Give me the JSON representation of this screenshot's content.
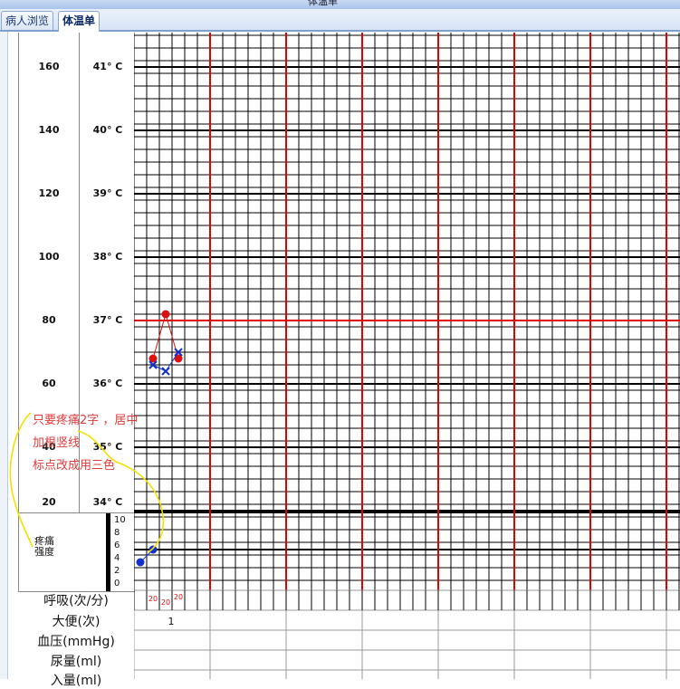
{
  "window": {
    "title": "体温单"
  },
  "tabs": [
    {
      "label": "病人浏览",
      "active": false
    },
    {
      "label": "体温单",
      "active": true
    }
  ],
  "pulse_scale": [
    "160",
    "140",
    "120",
    "100",
    "80",
    "60",
    "40",
    "20"
  ],
  "temp_scale": [
    "41° C",
    "40° C",
    "39° C",
    "38° C",
    "37° C",
    "36° C",
    "35° C",
    "34° C"
  ],
  "pain": {
    "label_line1": "疼痛",
    "label_line2": "强度",
    "scale": [
      "10",
      "8",
      "6",
      "4",
      "2",
      "0"
    ]
  },
  "rows": {
    "respiration": "呼吸(次/分)",
    "stool": "大便(次)",
    "blood_pressure": "血压(mmHg)",
    "urine": "尿量(ml)",
    "intake": "入量(ml)"
  },
  "values": {
    "respiration": [
      "20",
      "20",
      "20"
    ],
    "stool": "1"
  },
  "annotations": {
    "line1": "只要疼痛2字 ，居中",
    "line2": "加根竖线",
    "line3": "标点改成用三色"
  },
  "chart_data": {
    "type": "scatter",
    "temperature_red": [
      {
        "slot": 1,
        "temp": 36.4
      },
      {
        "slot": 2,
        "temp": 37.1
      },
      {
        "slot": 3,
        "temp": 36.4
      }
    ],
    "temperature_blue_x": [
      {
        "slot": 1,
        "temp": 36.3
      },
      {
        "slot": 2,
        "temp": 36.2
      },
      {
        "slot": 3,
        "temp": 36.5
      }
    ],
    "pain_points": [
      {
        "slot": 0,
        "pain": 3
      },
      {
        "slot": 1,
        "pain": 5
      }
    ],
    "temp_range": [
      34,
      41
    ],
    "pain_range": [
      0,
      10
    ],
    "colors": {
      "major": "#e00000",
      "grid": "#000000",
      "red_point": "#e01010",
      "blue_point": "#1030d0"
    }
  }
}
